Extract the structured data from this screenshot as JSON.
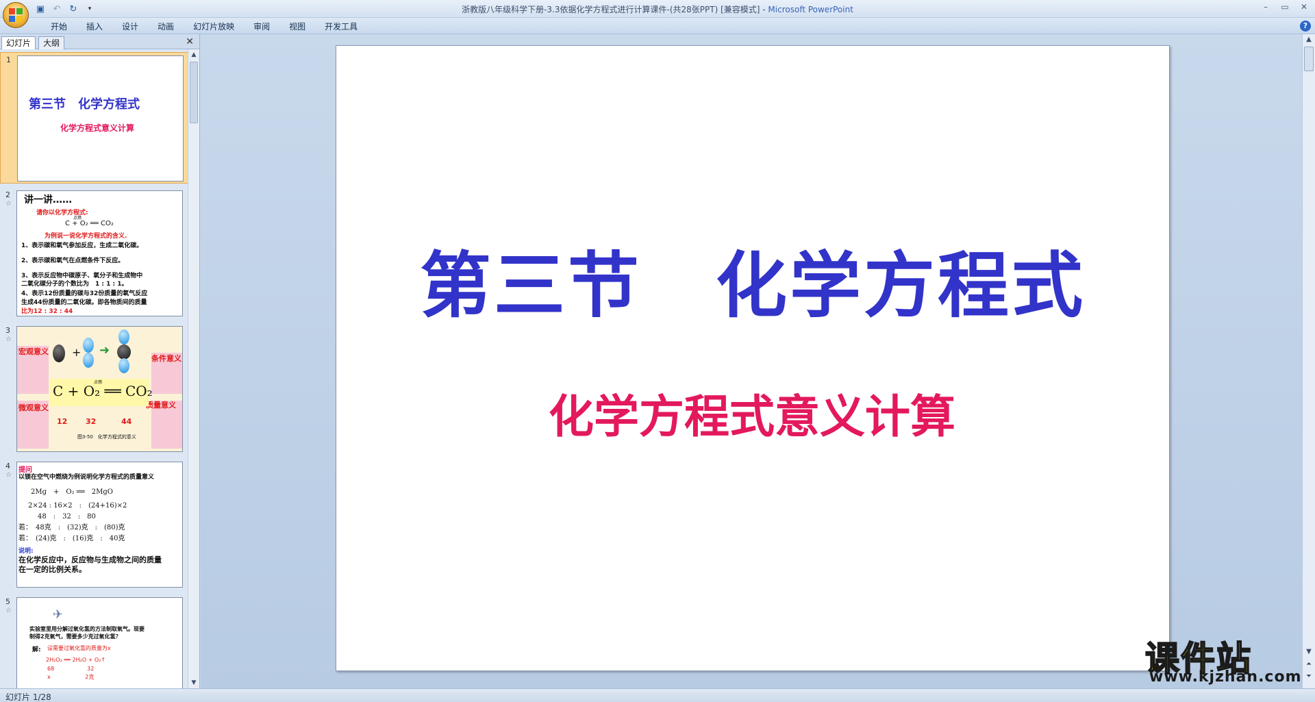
{
  "window": {
    "title": "浙教版八年级科学下册-3.3依据化学方程式进行计算课件-(共28张PPT) [兼容模式]",
    "app_name": "Microsoft PowerPoint",
    "separator": " - "
  },
  "ribbon": {
    "tabs": [
      "开始",
      "插入",
      "设计",
      "动画",
      "幻灯片放映",
      "审阅",
      "视图",
      "开发工具"
    ]
  },
  "left_panel": {
    "tabs": [
      "幻灯片",
      "大纲"
    ],
    "close": "✕",
    "thumbnails": [
      {
        "number": "1",
        "title": "第三节　化学方程式",
        "subtitle": "化学方程式意义计算"
      },
      {
        "number": "2",
        "heading": "讲一讲……",
        "prompt": "请你以化学方程式:",
        "equation": "C  +  O₂  ══  CO₂",
        "condition": "点燃",
        "instruction": "为例说一说化学方程式的含义.",
        "points": [
          "1、表示碳和氧气参加反应，生成二氧化碳。",
          "2、表示碳和氧气在点燃条件下反应。",
          "3、表示反应物中碳原子、氧分子和生成物中",
          "二氧化碳分子的个数比为　1 : 1 : 1。",
          "4、表示12份质量的碳与32份质量的氧气反应",
          "生成44份质量的二氧化碳。即各物质间的质量",
          "比为12 : 32 : 44"
        ]
      },
      {
        "number": "3",
        "labels": [
          "宏观意义",
          "条件意义",
          "微观意义",
          "质量意义"
        ],
        "equation": "C + O₂ ══ CO₂",
        "condition": "点燃",
        "masses": [
          "12",
          "32",
          "44"
        ],
        "caption": "图3-50　化学方程式的意义"
      },
      {
        "number": "4",
        "heading": "提问",
        "question": "以镁在空气中燃烧为例说明化学方程式的质量意义",
        "lines": [
          "2Mg　+　O₂ ══　2MgO",
          "2×24 : 16×2　:　(24+16)×2",
          "48　:　32　:　80",
          "若：　48克　:　(32)克　:　(80)克",
          "若：　(24)克　:　(16)克　:　40克"
        ],
        "note_label": "说明:",
        "note": "在化学反应中，反应物与生成物之间的质量",
        "note2": "在一定的比例关系。"
      },
      {
        "number": "5",
        "text1": "实验室里用分解过氧化氢的方法制取氧气。现要",
        "text2": "制得2克氧气，需要多少克过氧化氢？",
        "solve": "解:",
        "solve_text": "设需要过氧化氢的质量为x",
        "calc": [
          "2H₂O₂ ══ 2H₂O + O₂↑",
          "68　　　　　　32",
          "x　　　　　　 2克"
        ]
      }
    ]
  },
  "slide": {
    "title": "第三节　化学方程式",
    "subtitle": "化学方程式意义计算"
  },
  "status_bar": {
    "slide_info": "幻灯片 1/28"
  },
  "watermark": {
    "text": "课件站",
    "url": "www.kjzhan.com"
  },
  "colors": {
    "title_blue": "#3233c9",
    "subtitle_red": "#e3195c",
    "selection": "#fbd99a"
  }
}
